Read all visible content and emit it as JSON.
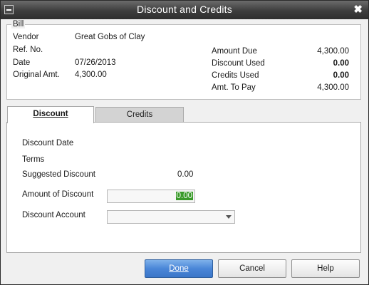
{
  "window": {
    "title": "Discount and Credits",
    "close_glyph": "✖"
  },
  "bill": {
    "legend": "Bill",
    "vendor_label": "Vendor",
    "vendor_value": "Great Gobs of Clay",
    "ref_label": "Ref. No.",
    "ref_value": "",
    "date_label": "Date",
    "date_value": "07/26/2013",
    "orig_label": "Original Amt.",
    "orig_value": "4,300.00",
    "amount_due_label": "Amount Due",
    "amount_due_value": "4,300.00",
    "discount_used_label": "Discount Used",
    "discount_used_value": "0.00",
    "credits_used_label": "Credits Used",
    "credits_used_value": "0.00",
    "amt_to_pay_label": "Amt. To Pay",
    "amt_to_pay_value": "4,300.00"
  },
  "tabs": [
    {
      "label": "Discount",
      "active": true
    },
    {
      "label": "Credits",
      "active": false
    }
  ],
  "discount": {
    "date_label": "Discount Date",
    "terms_label": "Terms",
    "suggested_label": "Suggested Discount",
    "suggested_value": "0.00",
    "amount_label": "Amount of Discount",
    "amount_value": "0.00",
    "account_label": "Discount Account",
    "account_value": ""
  },
  "buttons": {
    "done": "Done",
    "cancel": "Cancel",
    "help": "Help"
  },
  "colors": {
    "primary_button": "#4a86d8",
    "selection_highlight": "#3a9a2a"
  }
}
